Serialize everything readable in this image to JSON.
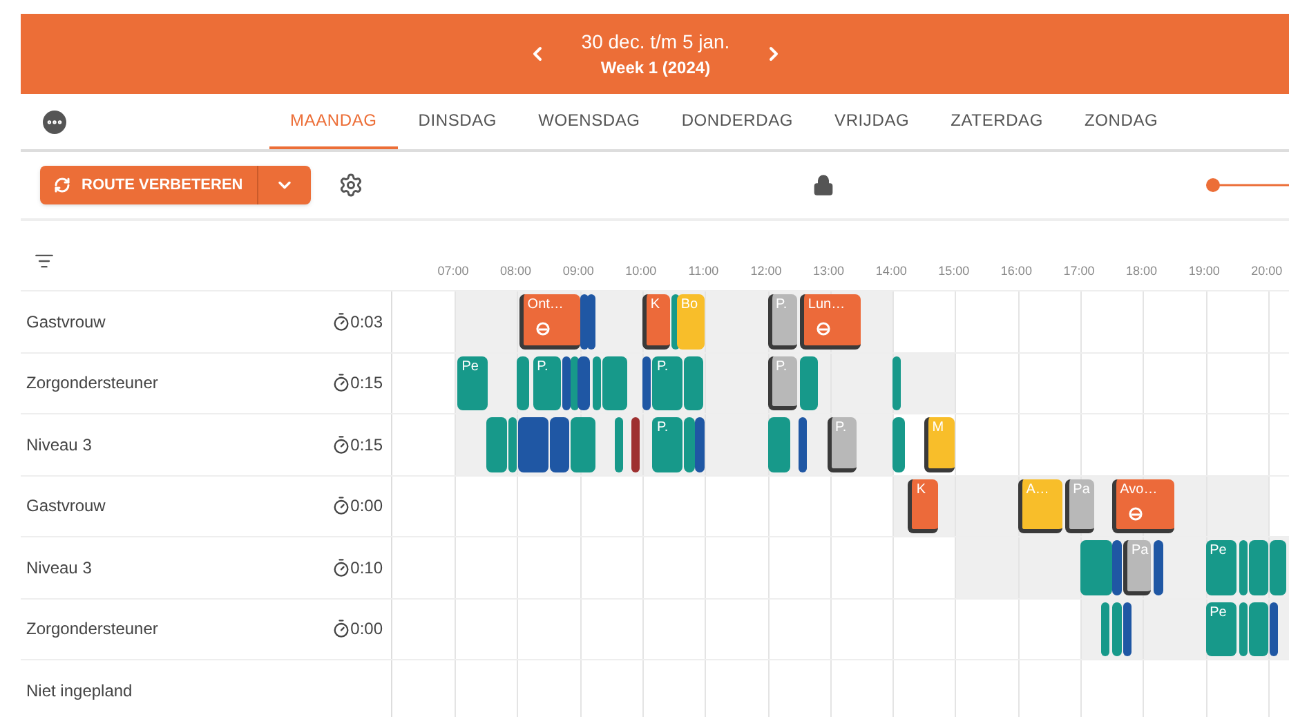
{
  "header": {
    "title": "30 dec. t/m 5 jan.",
    "subtitle": "Week 1 (2024)"
  },
  "tabs": [
    {
      "label": "MAANDAG",
      "selected": true
    },
    {
      "label": "DINSDAG",
      "selected": false
    },
    {
      "label": "WOENSDAG",
      "selected": false
    },
    {
      "label": "DONDERDAG",
      "selected": false
    },
    {
      "label": "VRIJDAG",
      "selected": false
    },
    {
      "label": "ZATERDAG",
      "selected": false
    },
    {
      "label": "ZONDAG",
      "selected": false
    }
  ],
  "toolbar": {
    "route_button": "ROUTE VERBETEREN",
    "locked": true
  },
  "timeline": {
    "hours": [
      "07:00",
      "08:00",
      "09:00",
      "10:00",
      "11:00",
      "12:00",
      "13:00",
      "14:00",
      "15:00",
      "16:00",
      "17:00",
      "18:00",
      "19:00",
      "20:00"
    ]
  },
  "rows": [
    {
      "name": "Gastvrouw",
      "time": "0:03",
      "blocks": [
        {
          "kind": "task",
          "color": "#ec6a3a",
          "label": "Ont…",
          "icon": true
        },
        {
          "kind": "visit",
          "color": "#1f57a4"
        },
        {
          "kind": "visit",
          "color": "#1f57a4"
        },
        {
          "kind": "task",
          "color": "#ec6a3a",
          "label": "K",
          "icon": false
        },
        {
          "kind": "visit",
          "color": "#17998a"
        },
        {
          "kind": "visit",
          "color": "#f8be2a",
          "label": "Bo"
        },
        {
          "kind": "task",
          "color": "#b8b8b8",
          "label": "P.",
          "icon": false
        },
        {
          "kind": "task",
          "color": "#ec6a3a",
          "label": "Lun…",
          "icon": true
        }
      ]
    },
    {
      "name": "Zorgondersteuner",
      "time": "0:15",
      "blocks": [
        {
          "kind": "visit",
          "color": "#17998a",
          "label": "Pe"
        },
        {
          "kind": "visit",
          "color": "#17998a"
        },
        {
          "kind": "visit",
          "color": "#17998a",
          "label": "P."
        },
        {
          "kind": "visit",
          "color": "#1f57a4"
        },
        {
          "kind": "visit",
          "color": "#17998a"
        },
        {
          "kind": "visit",
          "color": "#1f57a4"
        },
        {
          "kind": "visit",
          "color": "#17998a"
        },
        {
          "kind": "visit",
          "color": "#17998a"
        },
        {
          "kind": "visit",
          "color": "#1f57a4"
        },
        {
          "kind": "visit",
          "color": "#17998a",
          "label": "P."
        },
        {
          "kind": "visit",
          "color": "#17998a"
        },
        {
          "kind": "task",
          "color": "#b8b8b8",
          "label": "P.",
          "icon": false
        },
        {
          "kind": "visit",
          "color": "#17998a"
        },
        {
          "kind": "visit",
          "color": "#17998a"
        }
      ]
    },
    {
      "name": "Niveau 3",
      "time": "0:15",
      "blocks": [
        {
          "kind": "visit",
          "color": "#17998a"
        },
        {
          "kind": "visit",
          "color": "#17998a"
        },
        {
          "kind": "visit",
          "color": "#1f57a4"
        },
        {
          "kind": "visit",
          "color": "#1f57a4"
        },
        {
          "kind": "visit",
          "color": "#17998a"
        },
        {
          "kind": "visit",
          "color": "#17998a"
        },
        {
          "kind": "visit",
          "color": "#9e3030"
        },
        {
          "kind": "visit",
          "color": "#17998a",
          "label": "P."
        },
        {
          "kind": "visit",
          "color": "#17998a"
        },
        {
          "kind": "visit",
          "color": "#1f57a4"
        },
        {
          "kind": "visit",
          "color": "#17998a"
        },
        {
          "kind": "visit",
          "color": "#1f57a4"
        },
        {
          "kind": "task",
          "color": "#b8b8b8",
          "label": "P.",
          "icon": false
        },
        {
          "kind": "visit",
          "color": "#17998a"
        },
        {
          "kind": "task",
          "color": "#f8be2a",
          "label": "M",
          "icon": false
        }
      ]
    },
    {
      "name": "Gastvrouw",
      "time": "0:00",
      "blocks": [
        {
          "kind": "task",
          "color": "#ec6a3a",
          "label": "K",
          "icon": false
        },
        {
          "kind": "task",
          "color": "#f8be2a",
          "label": "A…",
          "icon": false
        },
        {
          "kind": "task",
          "color": "#b8b8b8",
          "label": "Pa",
          "icon": false
        },
        {
          "kind": "task",
          "color": "#ec6a3a",
          "label": "Avo…",
          "icon": true
        }
      ]
    },
    {
      "name": "Niveau 3",
      "time": "0:10",
      "blocks": [
        {
          "kind": "visit",
          "color": "#17998a"
        },
        {
          "kind": "visit",
          "color": "#1f57a4"
        },
        {
          "kind": "task",
          "color": "#b8b8b8",
          "label": "Pa",
          "icon": false
        },
        {
          "kind": "visit",
          "color": "#1f57a4"
        },
        {
          "kind": "visit",
          "color": "#17998a",
          "label": "Pe"
        },
        {
          "kind": "visit",
          "color": "#17998a"
        },
        {
          "kind": "visit",
          "color": "#17998a"
        },
        {
          "kind": "visit",
          "color": "#17998a"
        }
      ]
    },
    {
      "name": "Zorgondersteuner",
      "time": "0:00",
      "blocks": [
        {
          "kind": "visit",
          "color": "#17998a"
        },
        {
          "kind": "visit",
          "color": "#17998a"
        },
        {
          "kind": "visit",
          "color": "#1f57a4"
        },
        {
          "kind": "visit",
          "color": "#17998a",
          "label": "Pe"
        },
        {
          "kind": "visit",
          "color": "#17998a"
        },
        {
          "kind": "visit",
          "color": "#17998a"
        },
        {
          "kind": "visit",
          "color": "#1f57a4"
        }
      ]
    }
  ],
  "unplanned": {
    "name": "Niet ingepland"
  }
}
